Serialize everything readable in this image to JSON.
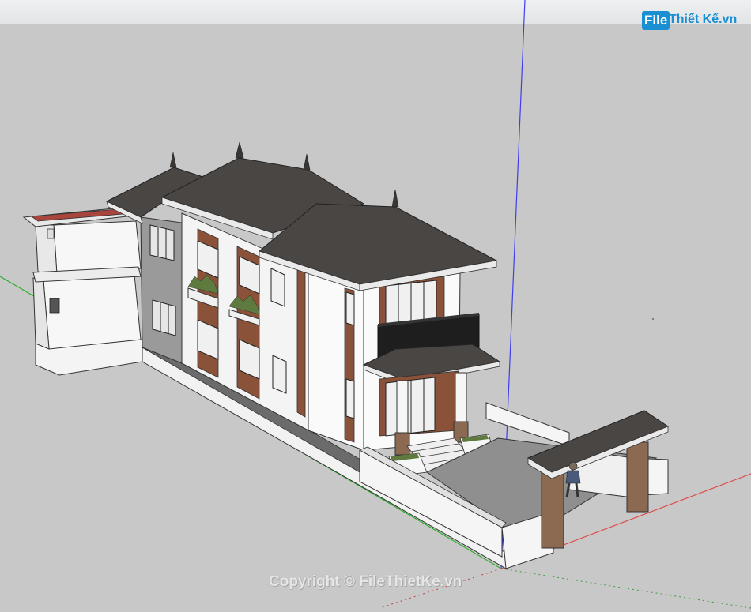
{
  "branding": {
    "logo_file": "File",
    "logo_rest": "Thiết Kế.vn"
  },
  "watermark": "Copyright © FileThietKe.vn",
  "scene": {
    "icons": [
      "blue-axis-icon",
      "green-axis-icon",
      "red-axis-icon",
      "human-figure-icon"
    ],
    "colors": {
      "background": "#c8c8c8",
      "roof": "#4a4644",
      "wall": "#ffffff",
      "wood": "#8a5238",
      "stone": "#8c6a52",
      "axis_blue": "#3e3eee",
      "axis_green": "#2fb02f",
      "axis_red": "#e04a4a"
    }
  }
}
